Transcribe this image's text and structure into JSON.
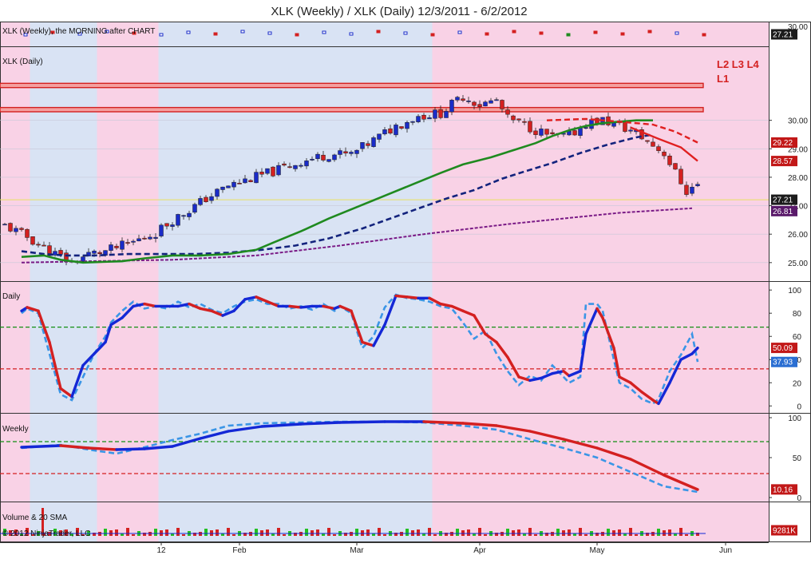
{
  "chart_data": {
    "type": "candlestick",
    "title": "XLK (Weekly) / XLK (Daily)  12/3/2011 - 6/2/2012",
    "colors": {
      "up": "#1a2cc8",
      "down": "#d42020",
      "sma_fast": "#1f8a1f",
      "sma_mid": "#13237d",
      "sma_slow": "#7a1a86",
      "res_fast": "#e02020",
      "stoch_blue": "#1428d6",
      "stoch_light": "#3a95e6",
      "hline_green": "#138f13",
      "hline_red": "#d42020",
      "bg_pink": "#f9d2e6",
      "bg_blue": "#d9e3f4",
      "band_fill": "#f4a0a0"
    },
    "x_ticks": [
      "12",
      "Feb",
      "Mar",
      "Apr",
      "May",
      "Jun"
    ],
    "background_regions": [
      {
        "from": "2011-12-03",
        "to": "2011-12-12",
        "color": "pink"
      },
      {
        "from": "2011-12-12",
        "to": "2011-12-28",
        "color": "blue"
      },
      {
        "from": "2011-12-28",
        "to": "2012-01-12",
        "color": "pink"
      },
      {
        "from": "2012-01-12",
        "to": "2012-03-21",
        "color": "blue"
      },
      {
        "from": "2012-03-21",
        "to": "2012-06-30",
        "color": "pink"
      }
    ],
    "panels": [
      {
        "name": "weekly-strip",
        "label": "XLK (Weekly), the MORNING after CHART",
        "y_ticks": [
          "30.00"
        ],
        "last_tag": "27.21"
      },
      {
        "name": "price",
        "label": "XLK (Daily)",
        "ylim": [
          24.35,
          32.6
        ],
        "y_ticks": [
          25.0,
          26.0,
          27.0,
          28.0,
          29.0,
          30.0
        ],
        "level_labels": [
          "L2 L3 L4",
          "L1"
        ],
        "resistance_bands": [
          [
            31.15,
            31.3
          ],
          [
            30.3,
            30.45
          ]
        ],
        "close_line": 27.21,
        "tags": [
          {
            "value": "29.22",
            "color": "red"
          },
          {
            "value": "28.57",
            "color": "red"
          },
          {
            "value": "27.21",
            "color": "dark"
          },
          {
            "value": "26.81",
            "color": "purple"
          }
        ],
        "sma_fast": [
          [
            3,
            25.2
          ],
          [
            7,
            25.25
          ],
          [
            10,
            25.1
          ],
          [
            14,
            25.0
          ],
          [
            21,
            25.05
          ],
          [
            25,
            25.15
          ],
          [
            30,
            25.25
          ],
          [
            35,
            25.25
          ],
          [
            40,
            25.3
          ],
          [
            45,
            25.45
          ],
          [
            48,
            25.7
          ],
          [
            53,
            26.1
          ],
          [
            58,
            26.55
          ],
          [
            63,
            26.95
          ],
          [
            68,
            27.35
          ],
          [
            73,
            27.75
          ],
          [
            78,
            28.15
          ],
          [
            82,
            28.45
          ],
          [
            87,
            28.7
          ],
          [
            91,
            28.95
          ],
          [
            95,
            29.2
          ],
          [
            98,
            29.45
          ],
          [
            101,
            29.65
          ],
          [
            104,
            29.8
          ],
          [
            107,
            29.9
          ],
          [
            110,
            29.95
          ],
          [
            113,
            30.0
          ],
          [
            116,
            30.0
          ]
        ],
        "sma_mid": [
          [
            3,
            25.4
          ],
          [
            7,
            25.3
          ],
          [
            11,
            25.25
          ],
          [
            16,
            25.25
          ],
          [
            22,
            25.3
          ],
          [
            28,
            25.3
          ],
          [
            34,
            25.3
          ],
          [
            40,
            25.35
          ],
          [
            46,
            25.45
          ],
          [
            52,
            25.6
          ],
          [
            58,
            25.85
          ],
          [
            64,
            26.2
          ],
          [
            69,
            26.55
          ],
          [
            74,
            26.9
          ],
          [
            79,
            27.25
          ],
          [
            84,
            27.55
          ],
          [
            89,
            27.95
          ],
          [
            93,
            28.2
          ],
          [
            98,
            28.5
          ],
          [
            103,
            28.85
          ],
          [
            108,
            29.15
          ],
          [
            113,
            29.4
          ],
          [
            116,
            29.5
          ]
        ],
        "sma_slow": [
          [
            3,
            25.0
          ],
          [
            15,
            25.05
          ],
          [
            30,
            25.1
          ],
          [
            45,
            25.25
          ],
          [
            60,
            25.6
          ],
          [
            75,
            26.0
          ],
          [
            90,
            26.35
          ],
          [
            100,
            26.55
          ],
          [
            110,
            26.75
          ],
          [
            123,
            26.91
          ]
        ],
        "sma_res": [
          [
            97,
            30.0
          ],
          [
            104,
            30.05
          ],
          [
            110,
            29.95
          ],
          [
            116,
            29.85
          ],
          [
            120,
            29.6
          ],
          [
            124,
            29.22
          ]
        ],
        "sma_res2": [
          [
            112,
            29.75
          ],
          [
            117,
            29.35
          ],
          [
            121,
            29.05
          ],
          [
            124,
            28.57
          ]
        ]
      },
      {
        "name": "daily-stoch",
        "label": "Daily",
        "ylim": [
          -6,
          107
        ],
        "y_ticks": [
          0,
          20,
          40,
          60,
          80,
          100
        ],
        "ob_line": 68,
        "os_line": 32,
        "tags": [
          {
            "value": "50.09",
            "color": "red"
          },
          {
            "value": "37.93",
            "color": "blue"
          }
        ],
        "k": [
          [
            3,
            82
          ],
          [
            4,
            85
          ],
          [
            6,
            82
          ],
          [
            8,
            55
          ],
          [
            10,
            15
          ],
          [
            12,
            8
          ],
          [
            14,
            35
          ],
          [
            16,
            45
          ],
          [
            18,
            55
          ],
          [
            19,
            70
          ],
          [
            21,
            76
          ],
          [
            23,
            86
          ],
          [
            25,
            88
          ],
          [
            27,
            86
          ],
          [
            29,
            86
          ],
          [
            31,
            86
          ],
          [
            33,
            88
          ],
          [
            35,
            84
          ],
          [
            37,
            82
          ],
          [
            39,
            78
          ],
          [
            41,
            82
          ],
          [
            43,
            92
          ],
          [
            45,
            94
          ],
          [
            47,
            90
          ],
          [
            49,
            86
          ],
          [
            51,
            86
          ],
          [
            53,
            85
          ],
          [
            55,
            86
          ],
          [
            57,
            86
          ],
          [
            59,
            84
          ],
          [
            60,
            86
          ],
          [
            62,
            82
          ],
          [
            64,
            55
          ],
          [
            66,
            52
          ],
          [
            68,
            70
          ],
          [
            70,
            95
          ],
          [
            72,
            94
          ],
          [
            74,
            93
          ],
          [
            76,
            93
          ],
          [
            78,
            88
          ],
          [
            80,
            86
          ],
          [
            82,
            82
          ],
          [
            84,
            78
          ],
          [
            86,
            62
          ],
          [
            88,
            55
          ],
          [
            90,
            42
          ],
          [
            92,
            25
          ],
          [
            94,
            22
          ],
          [
            96,
            24
          ],
          [
            98,
            28
          ],
          [
            100,
            30
          ],
          [
            101,
            26
          ],
          [
            103,
            30
          ],
          [
            104,
            62
          ],
          [
            106,
            84
          ],
          [
            107,
            76
          ],
          [
            109,
            50
          ],
          [
            110,
            25
          ],
          [
            112,
            20
          ],
          [
            114,
            12
          ],
          [
            116,
            5
          ],
          [
            117,
            2
          ],
          [
            119,
            20
          ],
          [
            121,
            40
          ],
          [
            123,
            45
          ],
          [
            124,
            50
          ]
        ],
        "d": [
          [
            3,
            80
          ],
          [
            4,
            84
          ],
          [
            6,
            80
          ],
          [
            8,
            45
          ],
          [
            10,
            10
          ],
          [
            12,
            5
          ],
          [
            14,
            25
          ],
          [
            16,
            45
          ],
          [
            18,
            60
          ],
          [
            19,
            72
          ],
          [
            21,
            82
          ],
          [
            23,
            90
          ],
          [
            25,
            84
          ],
          [
            27,
            86
          ],
          [
            29,
            84
          ],
          [
            31,
            90
          ],
          [
            33,
            85
          ],
          [
            35,
            88
          ],
          [
            37,
            83
          ],
          [
            39,
            80
          ],
          [
            41,
            86
          ],
          [
            43,
            90
          ],
          [
            45,
            92
          ],
          [
            47,
            88
          ],
          [
            49,
            88
          ],
          [
            51,
            84
          ],
          [
            53,
            86
          ],
          [
            55,
            83
          ],
          [
            57,
            88
          ],
          [
            59,
            82
          ],
          [
            60,
            86
          ],
          [
            62,
            80
          ],
          [
            64,
            50
          ],
          [
            66,
            60
          ],
          [
            68,
            85
          ],
          [
            70,
            96
          ],
          [
            72,
            93
          ],
          [
            74,
            92
          ],
          [
            76,
            90
          ],
          [
            78,
            86
          ],
          [
            80,
            84
          ],
          [
            82,
            72
          ],
          [
            84,
            58
          ],
          [
            86,
            65
          ],
          [
            88,
            45
          ],
          [
            90,
            30
          ],
          [
            92,
            18
          ],
          [
            94,
            26
          ],
          [
            96,
            22
          ],
          [
            98,
            35
          ],
          [
            100,
            25
          ],
          [
            101,
            20
          ],
          [
            103,
            25
          ],
          [
            104,
            88
          ],
          [
            106,
            88
          ],
          [
            107,
            82
          ],
          [
            109,
            40
          ],
          [
            110,
            20
          ],
          [
            112,
            15
          ],
          [
            114,
            6
          ],
          [
            116,
            2
          ],
          [
            117,
            6
          ],
          [
            119,
            30
          ],
          [
            121,
            44
          ],
          [
            123,
            62
          ],
          [
            124,
            38
          ]
        ]
      },
      {
        "name": "weekly-stoch",
        "label": "Weekly",
        "ylim": [
          -5,
          105
        ],
        "y_ticks": [
          0,
          50,
          100
        ],
        "ob_line": 70,
        "os_line": 30,
        "tags": [
          {
            "value": "10.16",
            "color": "red"
          }
        ],
        "k": [
          [
            3,
            63
          ],
          [
            10,
            65
          ],
          [
            15,
            62
          ],
          [
            20,
            60
          ],
          [
            25,
            61
          ],
          [
            30,
            64
          ],
          [
            35,
            74
          ],
          [
            40,
            83
          ],
          [
            46,
            89
          ],
          [
            53,
            92
          ],
          [
            60,
            94
          ],
          [
            68,
            95
          ],
          [
            75,
            95
          ],
          [
            82,
            93
          ],
          [
            88,
            90
          ],
          [
            94,
            83
          ],
          [
            100,
            73
          ],
          [
            106,
            62
          ],
          [
            112,
            48
          ],
          [
            118,
            28
          ],
          [
            124,
            10
          ]
        ],
        "d": [
          [
            3,
            62
          ],
          [
            10,
            66
          ],
          [
            15,
            60
          ],
          [
            20,
            55
          ],
          [
            25,
            63
          ],
          [
            30,
            72
          ],
          [
            35,
            80
          ],
          [
            40,
            90
          ],
          [
            46,
            93
          ],
          [
            53,
            94
          ],
          [
            60,
            95
          ],
          [
            68,
            95
          ],
          [
            75,
            94
          ],
          [
            82,
            90
          ],
          [
            88,
            85
          ],
          [
            94,
            73
          ],
          [
            100,
            62
          ],
          [
            106,
            50
          ],
          [
            112,
            32
          ],
          [
            118,
            14
          ],
          [
            124,
            7
          ]
        ]
      },
      {
        "name": "volume",
        "label": "Volume & 20 SMA",
        "last_tag": "9281K"
      }
    ],
    "footer": "© 2012 NinjaTrader, LLC"
  }
}
